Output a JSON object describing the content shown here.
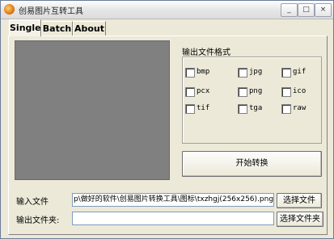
{
  "window": {
    "title": "创易图片互转工具",
    "minimize": "_",
    "maximize": "□",
    "close": "×"
  },
  "tabs": [
    {
      "label": "Single"
    },
    {
      "label": "Batch"
    },
    {
      "label": "About"
    }
  ],
  "format_section": {
    "label": "输出文件格式",
    "formats": [
      "bmp",
      "jpg",
      "gif",
      "pcx",
      "png",
      "ico",
      "tif",
      "tga",
      "raw"
    ]
  },
  "start_button": {
    "label": "开始转换"
  },
  "input_file": {
    "label": "输入文件",
    "value": "p\\做好的软件\\创易图片转换工具\\图标\\txzhgj(256x256).png",
    "browse_label": "选择文件"
  },
  "output_folder": {
    "label": "输出文件夹:",
    "value": "",
    "browse_label": "选择文件夹"
  }
}
